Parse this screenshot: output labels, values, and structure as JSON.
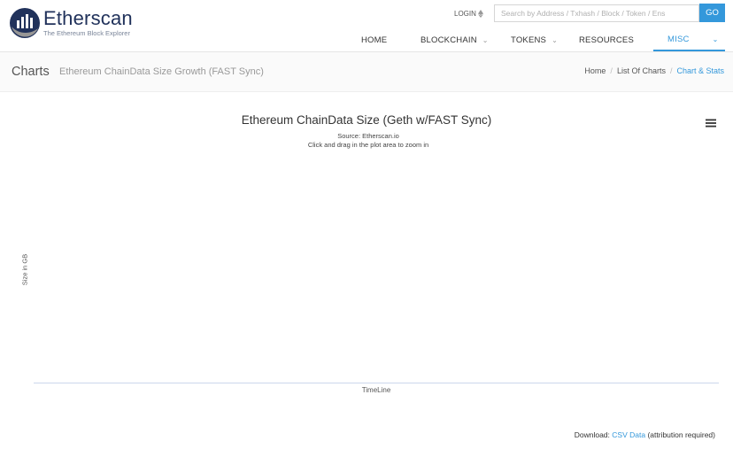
{
  "header": {
    "logo_name": "Etherscan",
    "logo_tagline": "The Ethereum Block Explorer",
    "login_label": "LOGIN",
    "search_placeholder": "Search by Address / Txhash / Block / Token / Ens",
    "go_label": "GO",
    "accent": "#3498db",
    "brand": "#21325b"
  },
  "nav": {
    "items": [
      {
        "label": "HOME"
      },
      {
        "label": "BLOCKCHAIN"
      },
      {
        "label": "TOKENS"
      },
      {
        "label": "RESOURCES"
      },
      {
        "label": "MISC"
      }
    ],
    "active": "MISC"
  },
  "page": {
    "title": "Charts",
    "subtitle": "Ethereum ChainData Size Growth (FAST Sync)",
    "breadcrumb": [
      "Home",
      "List Of Charts",
      "Chart & Stats"
    ]
  },
  "chart_data": {
    "type": "line",
    "title": "Ethereum ChainData Size (Geth w/FAST Sync)",
    "subtitle": "Source: Etherscan.io",
    "hint": "Click and drag in the plot area to zoom in",
    "xlabel": "TimeLine",
    "ylabel": "Size in GB",
    "series": [],
    "x": []
  },
  "footer": {
    "download_prefix": "Download:",
    "csv_link": "CSV Data",
    "suffix": "(attribution required)"
  }
}
